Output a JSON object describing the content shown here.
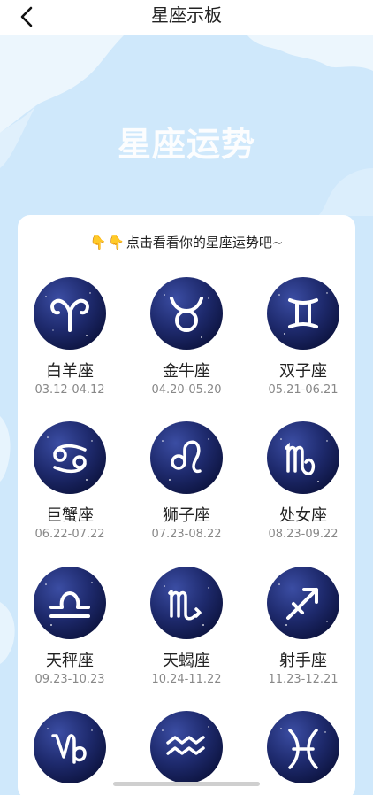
{
  "header": {
    "title": "星座示板",
    "back_icon": "chevron-left-icon"
  },
  "hero": {
    "title": "星座运势"
  },
  "card": {
    "hint_emoji": [
      "👇",
      "👇"
    ],
    "hint": "点击看看你的星座运势吧~",
    "signs": [
      {
        "name": "白羊座",
        "date": "03.12-04.12",
        "icon": "aries-icon"
      },
      {
        "name": "金牛座",
        "date": "04.20-05.20",
        "icon": "taurus-icon"
      },
      {
        "name": "双子座",
        "date": "05.21-06.21",
        "icon": "gemini-icon"
      },
      {
        "name": "巨蟹座",
        "date": "06.22-07.22",
        "icon": "cancer-icon"
      },
      {
        "name": "狮子座",
        "date": "07.23-08.22",
        "icon": "leo-icon"
      },
      {
        "name": "处女座",
        "date": "08.23-09.22",
        "icon": "virgo-icon"
      },
      {
        "name": "天秤座",
        "date": "09.23-10.23",
        "icon": "libra-icon"
      },
      {
        "name": "天蝎座",
        "date": "10.24-11.22",
        "icon": "scorpio-icon"
      },
      {
        "name": "射手座",
        "date": "11.23-12.21",
        "icon": "sagittarius-icon"
      },
      {
        "name": "",
        "date": "",
        "icon": "capricorn-icon"
      },
      {
        "name": "",
        "date": "",
        "icon": "aquarius-icon"
      },
      {
        "name": "",
        "date": "",
        "icon": "pisces-icon"
      }
    ]
  },
  "colors": {
    "sky": "#cfe8fb",
    "cloud": "#ffffff",
    "circle_dark": "#0d1440"
  }
}
